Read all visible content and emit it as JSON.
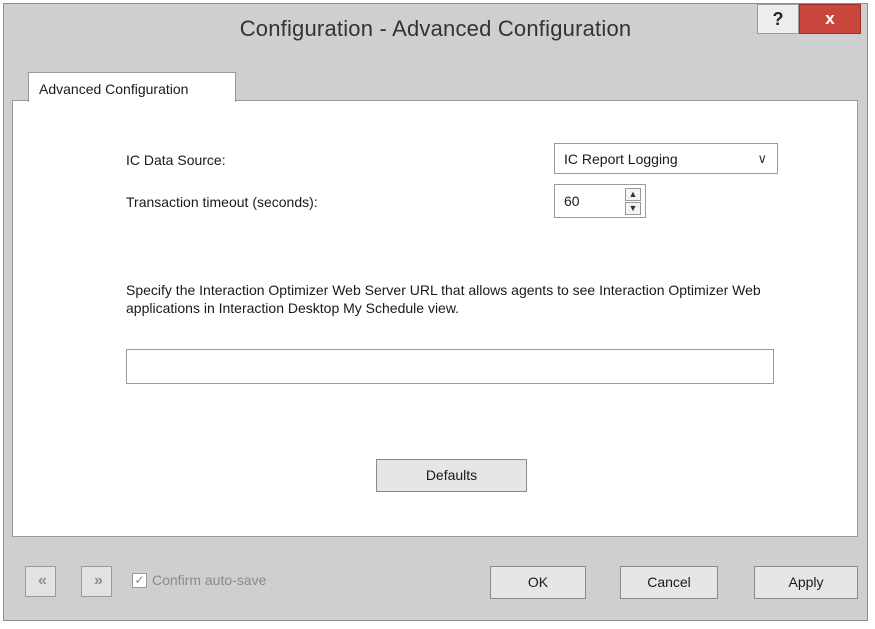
{
  "window": {
    "title": "Configuration - Advanced Configuration",
    "help_label": "?",
    "close_label": "x"
  },
  "tabs": [
    {
      "label": "Advanced Configuration",
      "active": true
    }
  ],
  "form": {
    "data_source_label": "IC Data Source:",
    "data_source_value": "IC Report Logging",
    "timeout_label": "Transaction timeout (seconds):",
    "timeout_value": "60",
    "description": "Specify the Interaction Optimizer Web Server URL that allows agents to see Interaction Optimizer Web applications in Interaction Desktop My Schedule view.",
    "url_value": "",
    "defaults_label": "Defaults"
  },
  "footer": {
    "prev_icon": "«",
    "next_icon": "»",
    "confirm_label": "Confirm auto-save",
    "confirm_checked": true,
    "ok_label": "OK",
    "cancel_label": "Cancel",
    "apply_label": "Apply"
  },
  "colors": {
    "close_button": "#c9463d",
    "chrome": "#cfcfcf",
    "panel": "#ffffff"
  },
  "icons": [
    "question-icon",
    "close-icon",
    "chevron-down-icon",
    "spin-up-icon",
    "spin-down-icon",
    "double-left-icon",
    "double-right-icon",
    "checkmark-icon"
  ]
}
